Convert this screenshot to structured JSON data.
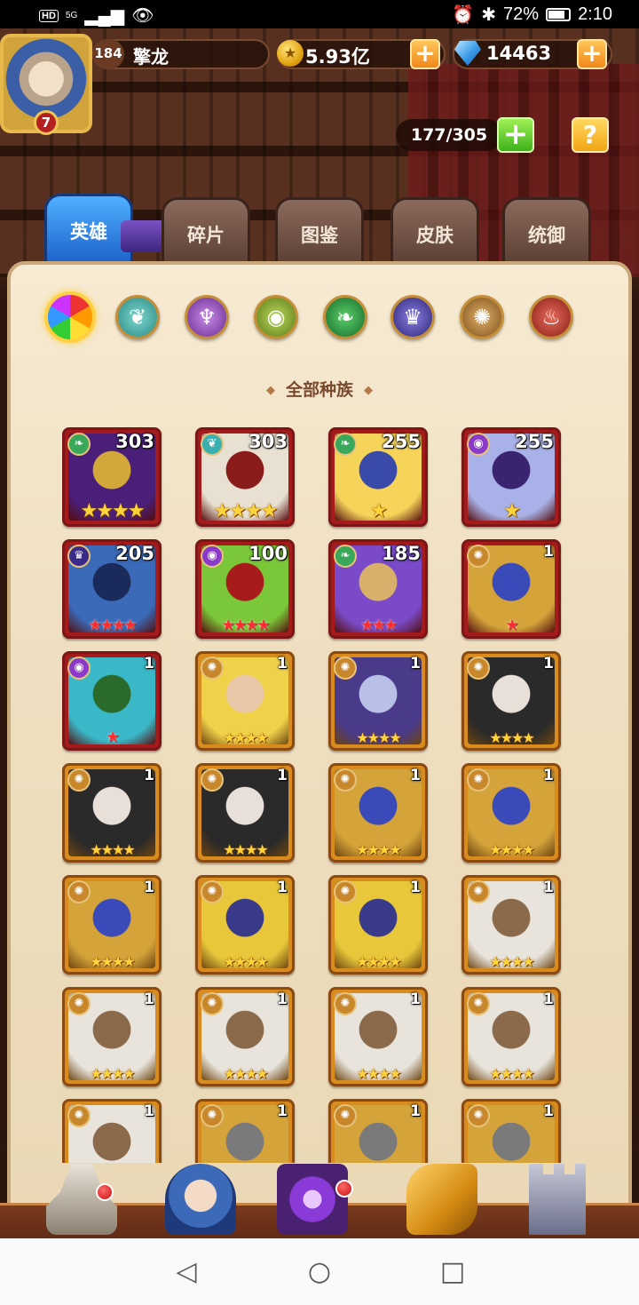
{
  "status_bar": {
    "hd": "HD",
    "network": "5G",
    "battery": "72%",
    "time": "2:10"
  },
  "player": {
    "avatar_level": "7",
    "level": "184",
    "name": "擎龙"
  },
  "resources": {
    "gold": "5.93亿",
    "gems": "14463"
  },
  "capacity": {
    "text": "177/305"
  },
  "tabs": [
    {
      "label": "英雄",
      "active": true
    },
    {
      "label": "碎片",
      "active": false
    },
    {
      "label": "图鉴",
      "active": false
    },
    {
      "label": "皮肤",
      "active": false
    },
    {
      "label": "统御",
      "active": false
    }
  ],
  "race_filter": {
    "title": "全部种族",
    "icons": [
      "all-races-icon",
      "race-water-icon",
      "race-abyss-icon",
      "race-forest-icon",
      "race-nature-icon",
      "race-dark-icon",
      "race-light-icon",
      "race-fire-icon"
    ]
  },
  "heroes": [
    {
      "level": "303",
      "stars": "★★★★",
      "star_type": "gold",
      "frame": "red",
      "race": "forest",
      "colors": [
        "#4a1f7a",
        "#d2a83a"
      ]
    },
    {
      "level": "303",
      "stars": "★★★★",
      "star_type": "gold",
      "frame": "red",
      "race": "water",
      "colors": [
        "#e8e0d0",
        "#8a1b1b"
      ]
    },
    {
      "level": "255",
      "stars": "★",
      "star_type": "gold",
      "frame": "red",
      "race": "forest",
      "colors": [
        "#f6d45a",
        "#3a4aa8"
      ]
    },
    {
      "level": "255",
      "stars": "★",
      "star_type": "gold",
      "frame": "red",
      "race": "abyss",
      "colors": [
        "#a9b2e8",
        "#3a2470"
      ]
    },
    {
      "level": "205",
      "stars": "★★★★",
      "star_type": "red",
      "frame": "red",
      "race": "dark",
      "colors": [
        "#3a6ab8",
        "#1a2a5a"
      ]
    },
    {
      "level": "100",
      "stars": "★★★★",
      "star_type": "red",
      "frame": "red",
      "race": "abyss",
      "colors": [
        "#7ac83a",
        "#a81b1b"
      ]
    },
    {
      "level": "185",
      "stars": "★★★",
      "star_type": "red",
      "frame": "red",
      "race": "forest",
      "colors": [
        "#7a4ac8",
        "#d9b06a"
      ]
    },
    {
      "level": "1",
      "stars": "★",
      "star_type": "red",
      "frame": "red",
      "race": "light",
      "colors": [
        "#d4a43a",
        "#3a4ab8"
      ]
    },
    {
      "level": "1",
      "stars": "★",
      "star_type": "red",
      "frame": "red",
      "race": "abyss",
      "colors": [
        "#3ab8c8",
        "#2a6a2a"
      ]
    },
    {
      "level": "1",
      "stars": "★★★★",
      "star_type": "gold",
      "frame": "orange",
      "race": "light",
      "colors": [
        "#f0d24a",
        "#e8c8a8"
      ]
    },
    {
      "level": "1",
      "stars": "★★★★",
      "star_type": "gold",
      "frame": "orange",
      "race": "light",
      "colors": [
        "#4a3a8a",
        "#b8c0e8"
      ]
    },
    {
      "level": "1",
      "stars": "★★★★",
      "star_type": "gold",
      "frame": "orange",
      "race": "light",
      "colors": [
        "#2a2a2a",
        "#e8e0d8"
      ]
    },
    {
      "level": "1",
      "stars": "★★★★",
      "star_type": "gold",
      "frame": "orange",
      "race": "light",
      "colors": [
        "#2a2a2a",
        "#e8e0d8"
      ]
    },
    {
      "level": "1",
      "stars": "★★★★",
      "star_type": "gold",
      "frame": "orange",
      "race": "light",
      "colors": [
        "#2a2a2a",
        "#e8e0d8"
      ]
    },
    {
      "level": "1",
      "stars": "★★★★",
      "star_type": "gold",
      "frame": "orange",
      "race": "light",
      "colors": [
        "#d4a43a",
        "#3a4ab8"
      ]
    },
    {
      "level": "1",
      "stars": "★★★★",
      "star_type": "gold",
      "frame": "orange",
      "race": "light",
      "colors": [
        "#d4a43a",
        "#3a4ab8"
      ]
    },
    {
      "level": "1",
      "stars": "★★★★",
      "star_type": "gold",
      "frame": "orange",
      "race": "light",
      "colors": [
        "#d4a43a",
        "#3a4ab8"
      ]
    },
    {
      "level": "1",
      "stars": "★★★★",
      "star_type": "gold",
      "frame": "orange",
      "race": "light",
      "colors": [
        "#e8c83a",
        "#3a3a8a"
      ]
    },
    {
      "level": "1",
      "stars": "★★★★",
      "star_type": "gold",
      "frame": "orange",
      "race": "light",
      "colors": [
        "#e8c83a",
        "#3a3a8a"
      ]
    },
    {
      "level": "1",
      "stars": "★★★★",
      "star_type": "gold",
      "frame": "orange",
      "race": "light",
      "colors": [
        "#e8e4dc",
        "#8a6a4a"
      ]
    },
    {
      "level": "1",
      "stars": "★★★★",
      "star_type": "gold",
      "frame": "orange",
      "race": "light",
      "colors": [
        "#e8e4dc",
        "#8a6a4a"
      ]
    },
    {
      "level": "1",
      "stars": "★★★★",
      "star_type": "gold",
      "frame": "orange",
      "race": "light",
      "colors": [
        "#e8e4dc",
        "#8a6a4a"
      ]
    },
    {
      "level": "1",
      "stars": "★★★★",
      "star_type": "gold",
      "frame": "orange",
      "race": "light",
      "colors": [
        "#e8e4dc",
        "#8a6a4a"
      ]
    },
    {
      "level": "1",
      "stars": "★★★★",
      "star_type": "gold",
      "frame": "orange",
      "race": "light",
      "colors": [
        "#e8e4dc",
        "#8a6a4a"
      ]
    },
    {
      "level": "1",
      "stars": "",
      "star_type": "gold",
      "frame": "orange",
      "race": "light",
      "colors": [
        "#e8e4dc",
        "#8a6a4a"
      ]
    },
    {
      "level": "1",
      "stars": "",
      "star_type": "gold",
      "frame": "orange",
      "race": "light",
      "colors": [
        "#d4a43a",
        "#7a7a7a"
      ]
    },
    {
      "level": "1",
      "stars": "",
      "star_type": "gold",
      "frame": "orange",
      "race": "light",
      "colors": [
        "#d4a43a",
        "#7a7a7a"
      ]
    },
    {
      "level": "1",
      "stars": "",
      "star_type": "gold",
      "frame": "orange",
      "race": "light",
      "colors": [
        "#d4a43a",
        "#7a7a7a"
      ]
    }
  ],
  "bottom_nav": [
    "castle-icon",
    "hero-portrait-icon",
    "summon-portal-icon",
    "treasure-scroll-icon",
    "tower-icon"
  ],
  "colors": {
    "race": {
      "forest": "#3aa85a",
      "water": "#3ab0b0",
      "abyss": "#8a3ac8",
      "dark": "#3a2a8a",
      "light": "#c8872a"
    }
  }
}
